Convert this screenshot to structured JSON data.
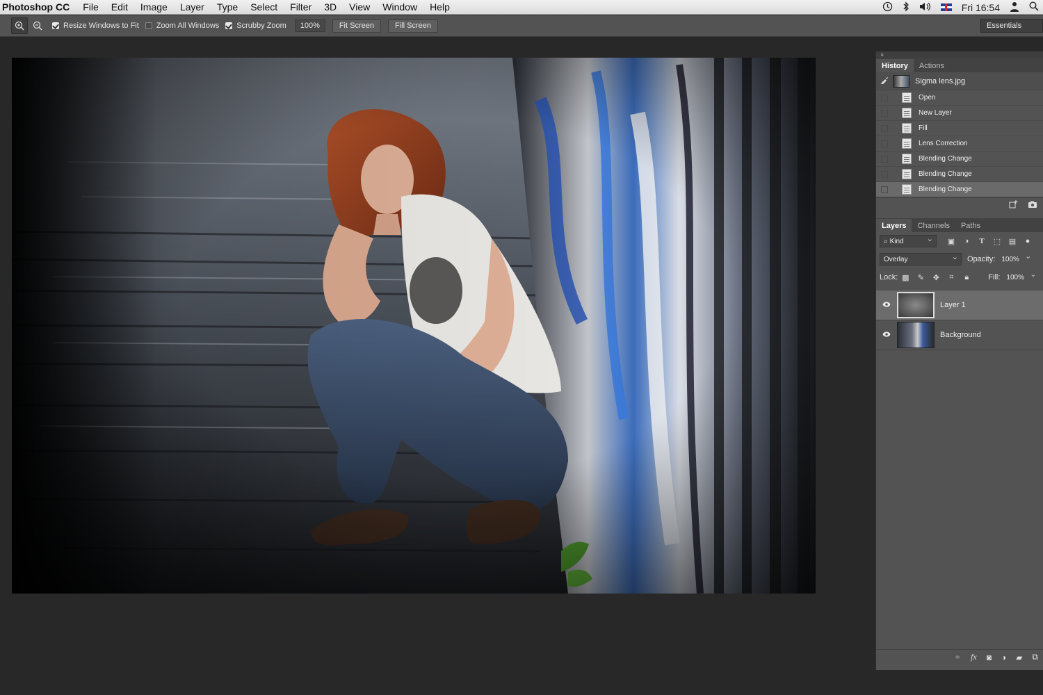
{
  "menubar": {
    "app_name": "Photoshop CC",
    "items": [
      "File",
      "Edit",
      "Image",
      "Layer",
      "Type",
      "Select",
      "Filter",
      "3D",
      "View",
      "Window",
      "Help"
    ],
    "clock": "Fri 16:54"
  },
  "options": {
    "resize_windows": {
      "label": "Resize Windows to Fit",
      "checked": true
    },
    "zoom_all_windows": {
      "label": "Zoom All Windows",
      "checked": false
    },
    "scrubby_zoom": {
      "label": "Scrubby Zoom",
      "checked": true
    },
    "zoom_value": "100%",
    "fit_screen_label": "Fit Screen",
    "fill_screen_label": "Fill Screen",
    "workspace": "Essentials"
  },
  "history_panel": {
    "close_glyph": "×",
    "tabs": [
      "History",
      "Actions"
    ],
    "snapshot_name": "Sigma lens.jpg",
    "states": [
      "Open",
      "New Layer",
      "Fill",
      "Lens Correction",
      "Blending Change",
      "Blending Change",
      "Blending Change"
    ],
    "selected_state": 6
  },
  "layers_panel": {
    "tabs": [
      "Layers",
      "Channels",
      "Paths"
    ],
    "filter_label": "Kind",
    "blend_mode": "Overlay",
    "opacity_label": "Opacity:",
    "opacity_value": "100%",
    "lock_label": "Lock:",
    "fill_label": "Fill:",
    "fill_value": "100%",
    "layers": [
      {
        "name": "Layer 1",
        "visible": true,
        "selected": true
      },
      {
        "name": "Background",
        "visible": true,
        "selected": false
      }
    ]
  }
}
